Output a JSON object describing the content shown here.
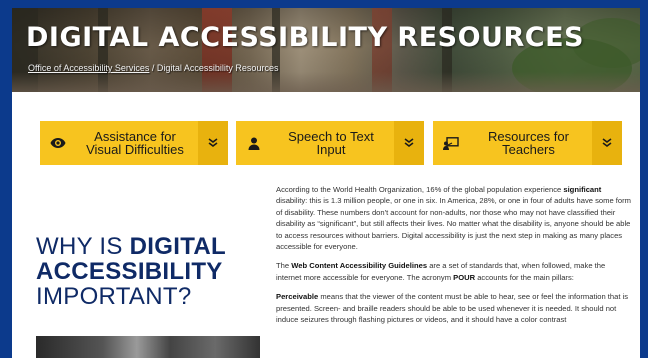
{
  "hero": {
    "title": "DIGITAL ACCESSIBILITY RESOURCES",
    "breadcrumb": {
      "parent": "Office of Accessibility Services",
      "separator": " / ",
      "current": "Digital Accessibility Resources"
    }
  },
  "buttons": [
    {
      "label_line1": "Assistance for",
      "label_line2": "Visual Difficulties",
      "icon": "eye-icon"
    },
    {
      "label_line1": "Speech to Text",
      "label_line2": "Input",
      "icon": "person-icon"
    },
    {
      "label_line1": "Resources for",
      "label_line2": "Teachers",
      "icon": "teacher-icon"
    }
  ],
  "colors": {
    "page_border": "#0c3a8c",
    "button_yellow": "#f7c41f",
    "button_chevron_bg": "#e8b20e",
    "heading_navy": "#0f2a66"
  },
  "heading": {
    "line1_light": "WHY IS ",
    "line1_bold": "DIGITAL",
    "line2_bold": "ACCESSIBILITY",
    "line3_light": "IMPORTANT?"
  },
  "paragraphs": {
    "p1_a": "According to the World Health Organization, 16% of the global population experience ",
    "p1_bold": "significant",
    "p1_b": " disability: this is 1.3 million people, or one in six. In America, 28%, or one in four of adults have some form of disability. These numbers don't account for non-adults, nor those who may not have classified their disability as “significant”, but still affects their lives. No matter what the disability is, anyone should be able to access resources without barriers. Digital accessibility is just the next step in making as many places accessible for everyone.",
    "p2_a": "The ",
    "p2_bold1": "Web Content Accessibility Guidelines",
    "p2_b": " are a set of standards that, when followed, make the internet more accessible for everyone. The acronym ",
    "p2_bold2": "POUR",
    "p2_c": " accounts for the main pillars:",
    "p3_bold": "Perceivable",
    "p3_a": " means that the viewer of the content must be able to hear, see or feel the information that is presented. Screen- and braille readers should be able to be used whenever it is needed. It should not induce seizures through flashing pictures or videos, and it should have a color contrast"
  }
}
